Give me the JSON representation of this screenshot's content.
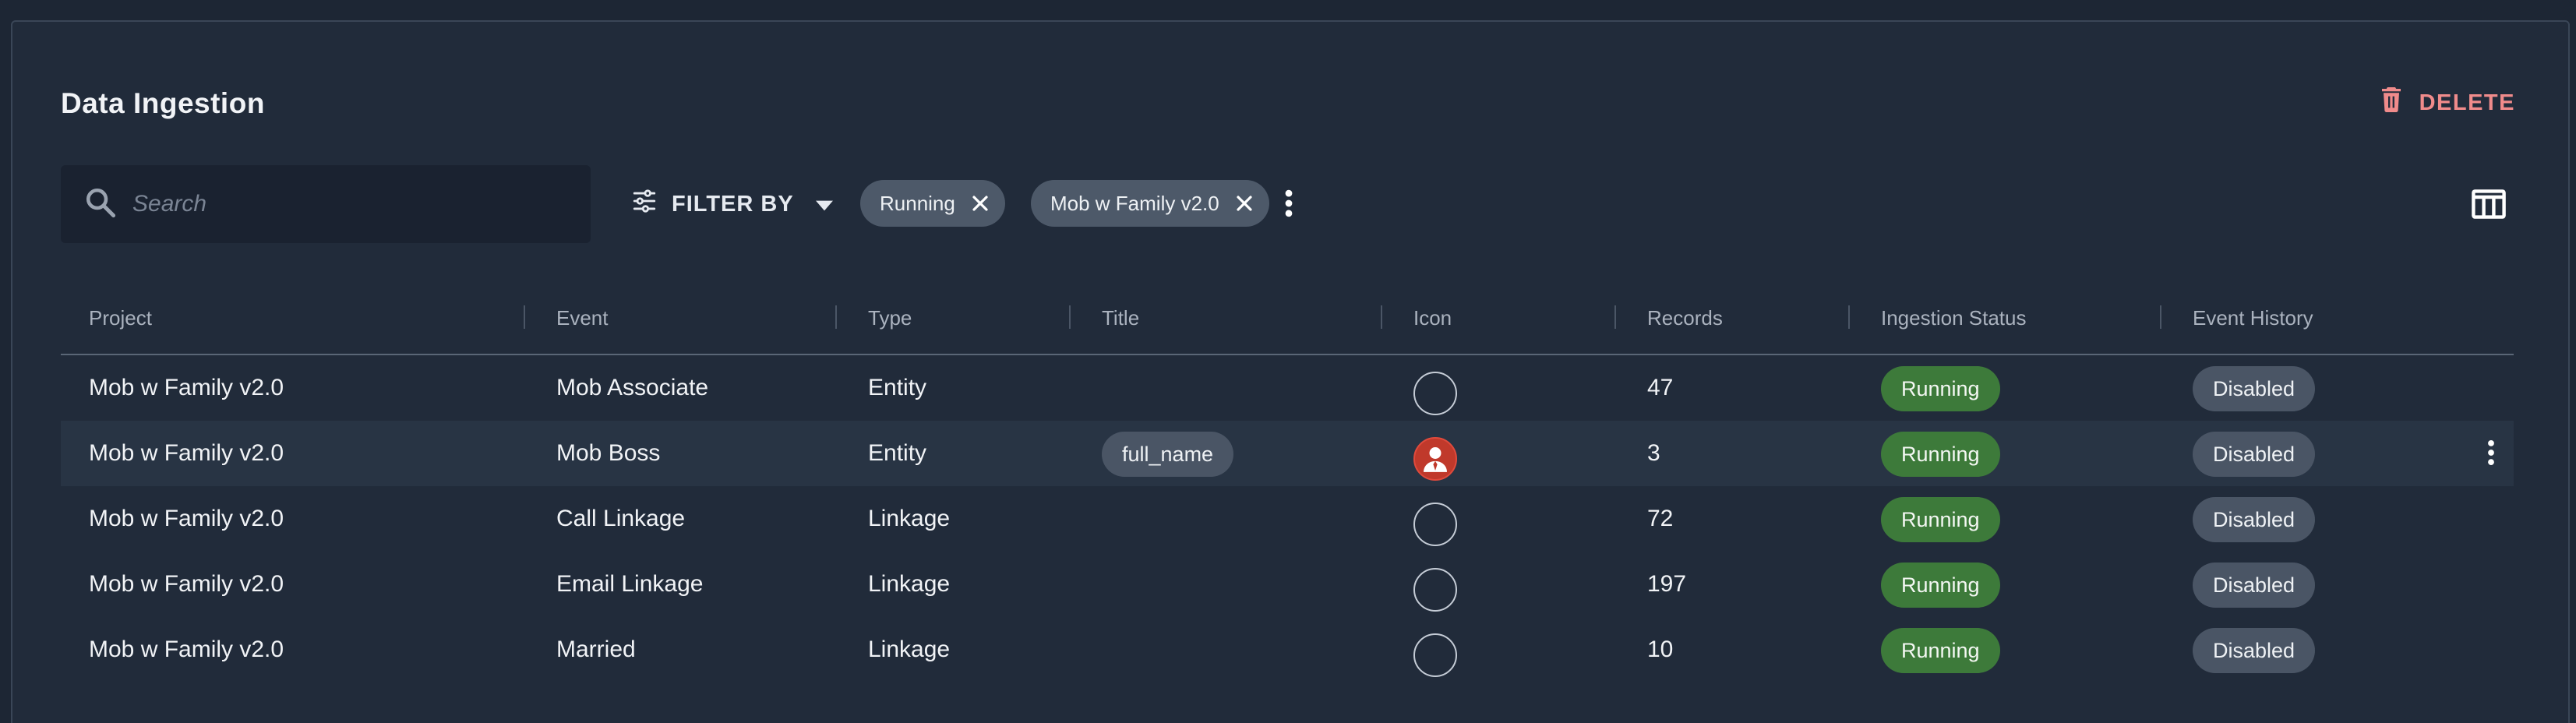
{
  "header": {
    "title": "Data Ingestion",
    "delete_label": "DELETE"
  },
  "toolbar": {
    "search_placeholder": "Search",
    "search_value": "",
    "filter_label": "FILTER BY",
    "chips": [
      {
        "label": "Running"
      },
      {
        "label": "Mob w Family v2.0"
      }
    ]
  },
  "table": {
    "columns": [
      "Project",
      "Event",
      "Type",
      "Title",
      "Icon",
      "Records",
      "Ingestion Status",
      "Event History"
    ],
    "rows": [
      {
        "project": "Mob w Family v2.0",
        "event": "Mob Associate",
        "type": "Entity",
        "title": "",
        "icon": "empty-circle-icon",
        "records": "47",
        "status": "Running",
        "history": "Disabled"
      },
      {
        "project": "Mob w Family v2.0",
        "event": "Mob Boss",
        "type": "Entity",
        "title": "full_name",
        "icon": "person-avatar-icon",
        "records": "3",
        "status": "Running",
        "history": "Disabled"
      },
      {
        "project": "Mob w Family v2.0",
        "event": "Call Linkage",
        "type": "Linkage",
        "title": "",
        "icon": "empty-circle-icon",
        "records": "72",
        "status": "Running",
        "history": "Disabled"
      },
      {
        "project": "Mob w Family v2.0",
        "event": "Email Linkage",
        "type": "Linkage",
        "title": "",
        "icon": "empty-circle-icon",
        "records": "197",
        "status": "Running",
        "history": "Disabled"
      },
      {
        "project": "Mob w Family v2.0",
        "event": "Married",
        "type": "Linkage",
        "title": "",
        "icon": "empty-circle-icon",
        "records": "10",
        "status": "Running",
        "history": "Disabled"
      }
    ]
  },
  "colors": {
    "background": "#212b3a",
    "running": "#3d7a3a",
    "disabled": "#4a5565",
    "delete": "#f08b8b",
    "avatar": "#c0392b"
  }
}
